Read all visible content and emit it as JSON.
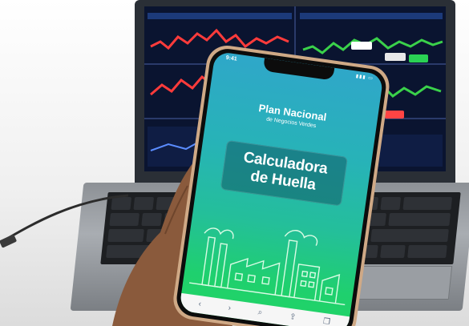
{
  "phone": {
    "status_time": "9:41",
    "brand_title_line1": "Plan Nacional",
    "brand_subtitle": "de Negocios Verdes",
    "card_line1": "Calculadora",
    "card_line2": "de Huella"
  },
  "browser_bar_icons": [
    "back-icon",
    "forward-icon",
    "search-icon",
    "share-icon",
    "tabs-icon"
  ],
  "colors": {
    "screen_top": "#2fa7c9",
    "screen_bottom": "#22d464",
    "phone_frame": "#cfa986",
    "laptop_screen": "#0a1430"
  }
}
